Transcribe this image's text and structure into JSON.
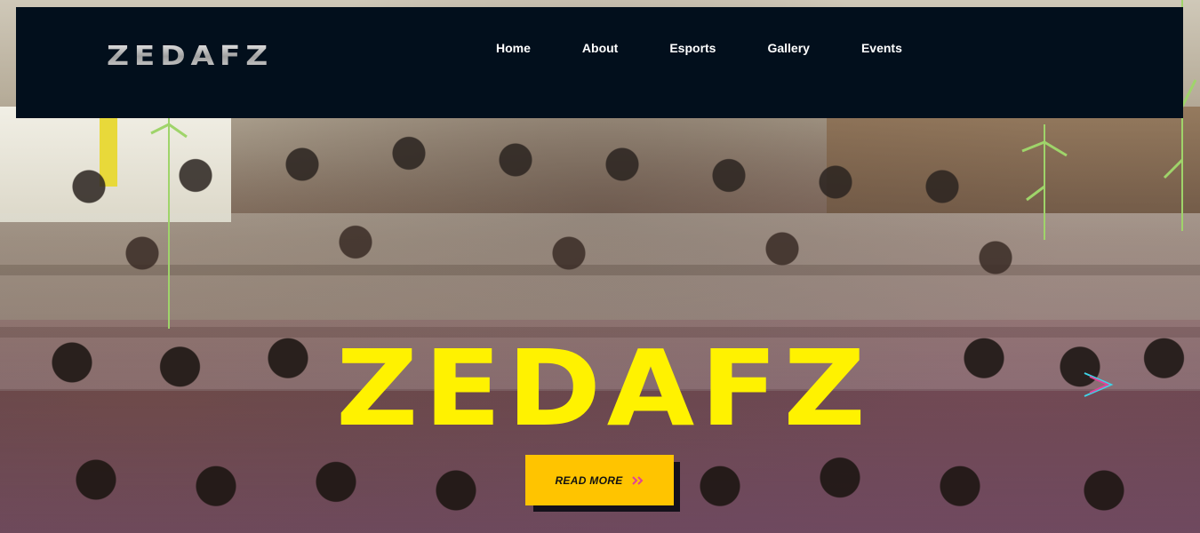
{
  "header": {
    "logo": "ZEDAFZ",
    "nav": [
      {
        "label": "Home"
      },
      {
        "label": "About"
      },
      {
        "label": "Esports"
      },
      {
        "label": "Gallery"
      },
      {
        "label": "Events"
      }
    ]
  },
  "hero": {
    "title": "ZEDAFZ",
    "button_label": "READ MORE",
    "button_icon": "double-chevron-right-icon"
  },
  "colors": {
    "navbar_bg": "#020f1c",
    "title_yellow": "#fff200",
    "button_yellow": "#ffc400",
    "chevron_pink": "#e0449a",
    "arrow_cyan": "#3fd2e6"
  }
}
